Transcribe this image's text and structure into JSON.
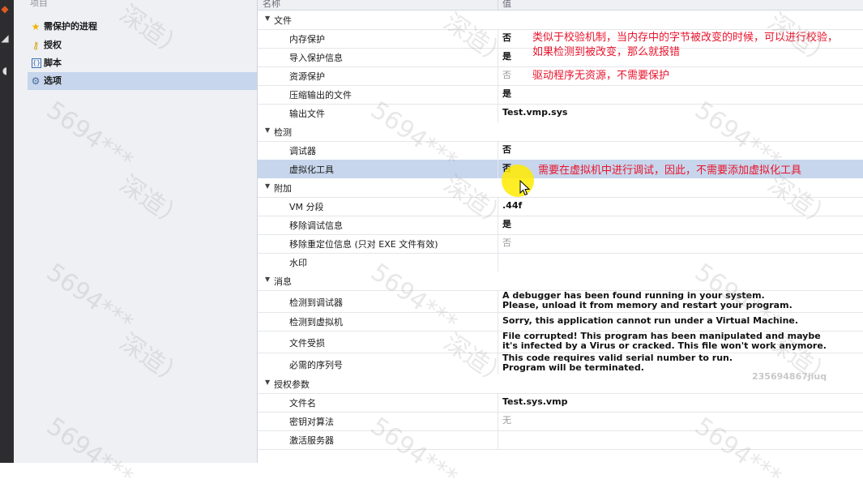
{
  "tree": {
    "header": "项目",
    "items": [
      {
        "label": "需保护的进程",
        "icon": "star-icon",
        "selected": false
      },
      {
        "label": "授权",
        "icon": "key-icon",
        "selected": false
      },
      {
        "label": "脚本",
        "icon": "script-icon",
        "selected": false
      },
      {
        "label": "选项",
        "icon": "gear-icon",
        "selected": true
      }
    ]
  },
  "grid": {
    "header_name": "名称",
    "header_value": "值",
    "sections": [
      {
        "label": "文件",
        "rows": [
          {
            "name": "内存保护",
            "value": "否",
            "style": "bold"
          },
          {
            "name": "导入保护信息",
            "value": "是",
            "style": "bold"
          },
          {
            "name": "资源保护",
            "value": "否",
            "style": "gray"
          },
          {
            "name": "压缩输出的文件",
            "value": "是",
            "style": "bold"
          },
          {
            "name": "输出文件",
            "value": "Test.vmp.sys",
            "style": "bold"
          }
        ]
      },
      {
        "label": "检测",
        "rows": [
          {
            "name": "调试器",
            "value": "否",
            "style": "bold"
          },
          {
            "name": "虚拟化工具",
            "value": "否",
            "style": "bold",
            "highlight": true
          }
        ]
      },
      {
        "label": "附加",
        "rows": [
          {
            "name": "VM 分段",
            "value": ".44f",
            "style": "bold"
          },
          {
            "name": "移除调试信息",
            "value": "是",
            "style": "bold"
          },
          {
            "name": "移除重定位信息 (只对 EXE 文件有效)",
            "value": "否",
            "style": "gray"
          },
          {
            "name": "水印",
            "value": "",
            "style": "bold"
          }
        ]
      },
      {
        "label": "消息",
        "rows": [
          {
            "name": "检测到调试器",
            "value": "A debugger has been found running in your system.\nPlease, unload it from memory and restart your program.",
            "style": "bold",
            "tall": true
          },
          {
            "name": "检测到虚拟机",
            "value": "Sorry, this application cannot run under a Virtual Machine.",
            "style": "bold"
          },
          {
            "name": "文件受损",
            "value": "File corrupted! This program has been manipulated and maybe\nit's infected by a Virus or cracked. This file won't work anymore.",
            "style": "bold",
            "tall": true
          },
          {
            "name": "必需的序列号",
            "value": "This code requires valid serial number to run.\nProgram will be terminated.",
            "style": "bold",
            "tall": true
          }
        ]
      },
      {
        "label": "授权参数",
        "rows": [
          {
            "name": "文件名",
            "value": "Test.sys.vmp",
            "style": "bold"
          },
          {
            "name": "密钥对算法",
            "value": "无",
            "style": "gray"
          },
          {
            "name": "激活服务器",
            "value": "",
            "style": "bold"
          }
        ]
      }
    ]
  },
  "annotations": {
    "a1_line1": "类似于校验机制，当内存中的字节被改变的时候，可以进行校验，",
    "a1_line2": "如果检测到被改变，那么就报错",
    "a2": "驱动程序无资源，不需要保护",
    "a3": "需要在虚拟机中进行调试，因此，不需要添加虚拟化工具"
  },
  "watermark": {
    "text1": "5694***",
    "text2": "深造）",
    "corner": "235694867jiuq"
  },
  "colors": {
    "selection": "#c7d6ec",
    "annotation": "#e8142c",
    "cursor_highlight": "#ffeb00"
  }
}
